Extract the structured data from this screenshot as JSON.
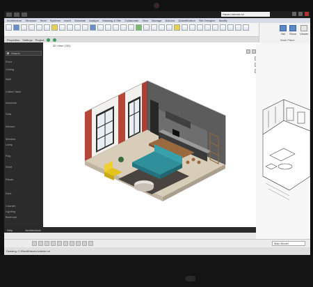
{
  "window": {
    "title": "Haven-Interior.rvt"
  },
  "menu": [
    "Architecture",
    "Structure",
    "Steel",
    "Systems",
    "Insert",
    "Annotate",
    "Analyze",
    "Massing & Site",
    "Collaborate",
    "View",
    "Manage",
    "Add-Ins",
    "Quantification",
    "Site Designer",
    "Modify"
  ],
  "ribbon_right": {
    "buttons": [
      "Set",
      "Show",
      "Viewer"
    ],
    "caption": "Work Plane"
  },
  "subtabs": [
    "Properties",
    "Settings",
    "Project"
  ],
  "left_panel": {
    "search_placeholder": "Search",
    "items": [
      "Floor",
      "Ceiling",
      "Wall",
      "Coffee Table",
      "Armchair",
      "Sofa",
      "Kitchen",
      "Window",
      "Lamp",
      "Rug",
      "Shelf",
      "Plants",
      "Door",
      "Counter",
      "Lighting",
      "Bedroom"
    ]
  },
  "viewport": {
    "tab_label": "3D View: {3D}"
  },
  "app_status": {
    "left": "Help",
    "right": "Architectural"
  },
  "bottom_toolbar": {
    "field": "Main Model"
  },
  "statusline": {
    "text": "Drawing: C:\\Revit\\Haven-Interior.rvt"
  },
  "colors": {
    "brick": "#b5473a",
    "sofa": "#2f8f9a",
    "armchair": "#e4c21c",
    "floor": "#d8cdb8",
    "rug": "#4a4440",
    "wall_dark": "#5c5c5c"
  }
}
